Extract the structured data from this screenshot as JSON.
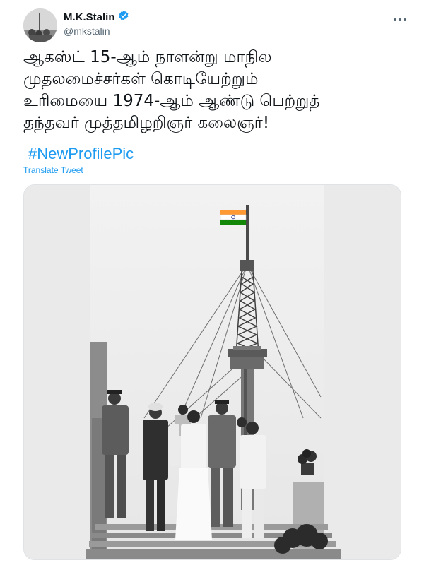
{
  "user": {
    "display_name": "M.K.Stalin",
    "handle": "@mkstalin",
    "verified": true
  },
  "tweet": {
    "lines": [
      "ஆகஸ்ட் 15-ஆம் நாளன்று மாநில",
      "முதலமைச்சர்கள் கொடியேற்றும்",
      "உரிமையை 1974-ஆம் ஆண்டு பெற்றுத்",
      "தந்தவர் முத்தமிழறிஞர் கலைஞர்!"
    ],
    "hashtag": "#NewProfilePic",
    "translate_label": "Translate Tweet"
  },
  "icons": {
    "verified": "verified-badge-icon",
    "more": "more-options-icon"
  },
  "colors": {
    "link": "#1d9bf0",
    "text": "#0f1419",
    "secondary": "#536471",
    "flag_saffron": "#ff9933",
    "flag_green": "#138808"
  }
}
